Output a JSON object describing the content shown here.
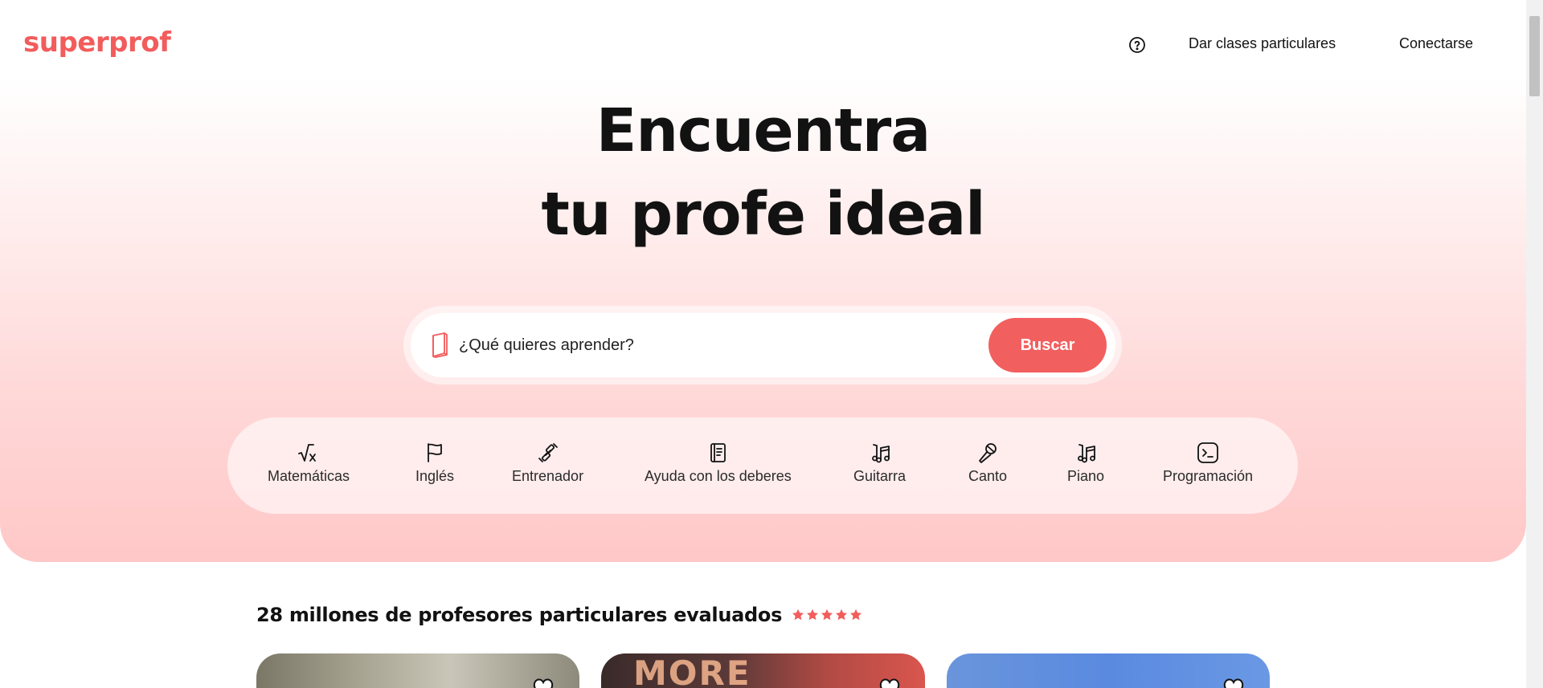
{
  "header": {
    "logo": "superprof",
    "help_icon": "question-circle-icon",
    "teach_label": "Dar clases particulares",
    "login_label": "Conectarse"
  },
  "hero": {
    "title_line1": "Encuentra",
    "title_line2": "tu profe ideal"
  },
  "search": {
    "icon": "book-icon",
    "placeholder": "¿Qué quieres aprender?",
    "value": "",
    "button_label": "Buscar"
  },
  "categories": [
    {
      "label": "Matemáticas",
      "icon": "square-root-icon"
    },
    {
      "label": "Inglés",
      "icon": "flag-icon"
    },
    {
      "label": "Entrenador",
      "icon": "dumbbell-icon"
    },
    {
      "label": "Ayuda con los deberes",
      "icon": "notebook-icon"
    },
    {
      "label": "Guitarra",
      "icon": "music-notes-icon"
    },
    {
      "label": "Canto",
      "icon": "microphone-icon"
    },
    {
      "label": "Piano",
      "icon": "music-notes-icon"
    },
    {
      "label": "Programación",
      "icon": "terminal-icon"
    }
  ],
  "stats": {
    "text": "28 millones de profesores particulares evaluados",
    "rating_stars": 5
  },
  "cards": [
    {
      "favorite_icon": "heart-icon"
    },
    {
      "favorite_icon": "heart-icon",
      "photo_text": "MORE"
    },
    {
      "favorite_icon": "heart-icon"
    }
  ],
  "colors": {
    "brand": "#f25c5c",
    "search_button": "#f25f5f",
    "hero_bottom": "#ffc7c7"
  }
}
